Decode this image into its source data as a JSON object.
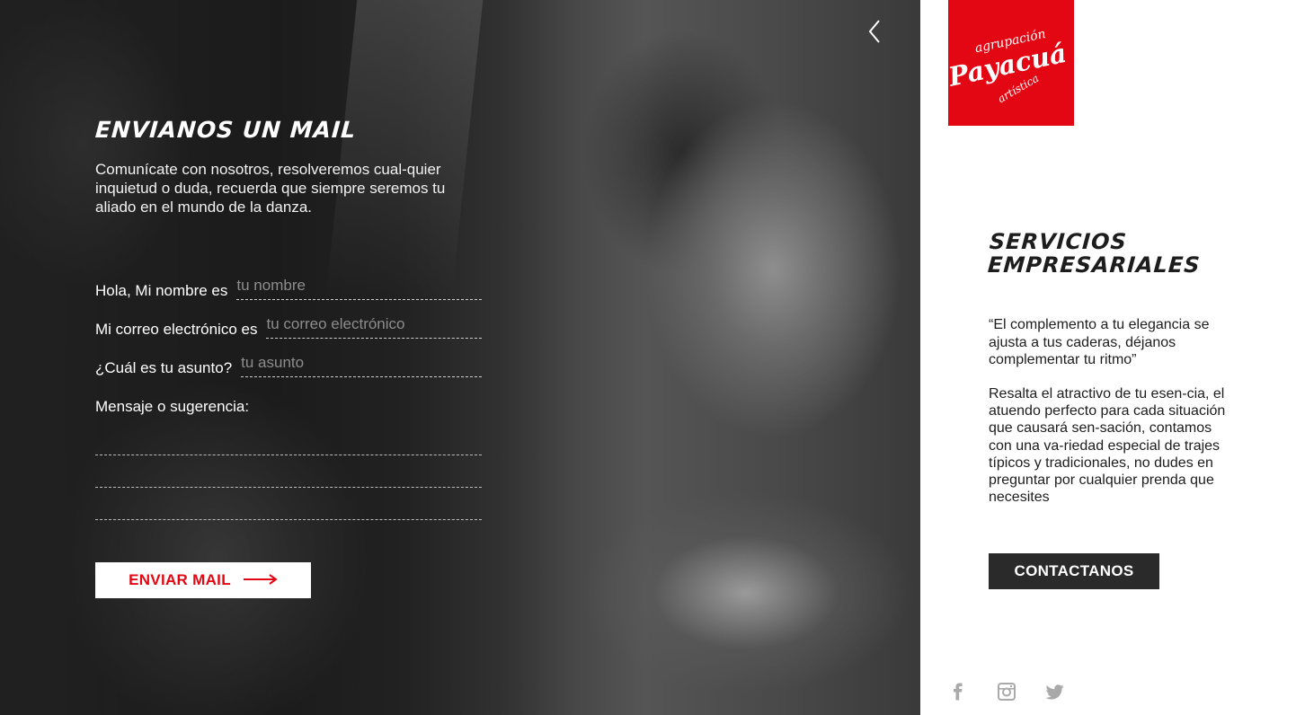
{
  "form": {
    "title": "Envianos un mail",
    "description": "Comunícate con nosotros, resolveremos cual-quier inquietud o duda, recuerda que siempre seremos tu aliado en el mundo de la danza.",
    "name_label": "Hola, Mi nombre es",
    "name_placeholder": "tu nombre",
    "email_label": "Mi correo electrónico es",
    "email_placeholder": "tu correo electrónico",
    "subject_label": "¿Cuál es tu asunto?",
    "subject_placeholder": "tu asunto",
    "message_label": "Mensaje o sugerencia:",
    "send_label": "ENVIAR MAIL"
  },
  "logo": {
    "line1": "agrupación",
    "line2": "Payacuá",
    "line3": "artística",
    "color": "#e30613"
  },
  "services": {
    "title_line1": "Servicios",
    "title_line2": "Empresariales",
    "quote": "“El complemento a tu elegancia se ajusta a tus caderas, déjanos complementar tu ritmo”",
    "description": "Resalta el atractivo de tu esen-cia, el atuendo perfecto para cada situación que causará sen-sación, contamos con una va-riedad especial de trajes típicos y tradicionales, no dudes en preguntar por cualquier prenda que necesites",
    "contact_label": "CONTACTANOS"
  },
  "icons": {
    "back": "chevron-left-icon",
    "arrow": "arrow-right-icon",
    "facebook": "facebook-icon",
    "instagram": "instagram-icon",
    "twitter": "twitter-icon"
  },
  "colors": {
    "accent": "#e30613",
    "dark": "#2a2a2a"
  }
}
